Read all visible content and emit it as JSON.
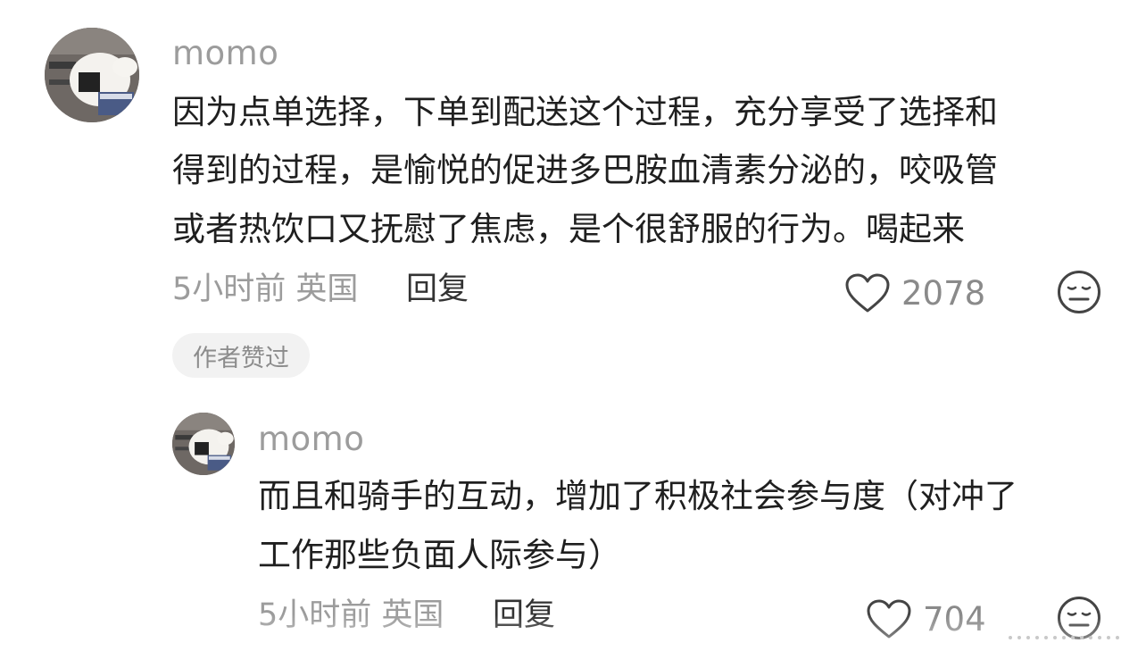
{
  "comment": {
    "username": "momo",
    "text_lines": [
      "因为点单选择，下单到配送这个过程，充分享受了选择和",
      "得到的过程，是愉悦的促进多巴胺血清素分泌的，咬吸管",
      "或者热饮口又抚慰了焦虑，是个很舒服的行为。喝起来"
    ],
    "time_location": "5小时前 英国",
    "reply_label": "回复",
    "like_count": "2078",
    "author_badge": "作者赞过"
  },
  "reply": {
    "username": "momo",
    "text_lines": [
      "而且和骑手的互动，增加了积极社会参与度（对冲了",
      "工作那些负面人际参与）"
    ],
    "time_location": "5小时前 英国",
    "reply_label": "回复",
    "like_count": "704"
  },
  "icons": {
    "like": "heart-outline-icon",
    "dislike": "meh-face-icon"
  },
  "colors": {
    "text": "#1f1f1f",
    "meta": "#9c9c9c",
    "badge_bg": "#f2f2f2"
  }
}
